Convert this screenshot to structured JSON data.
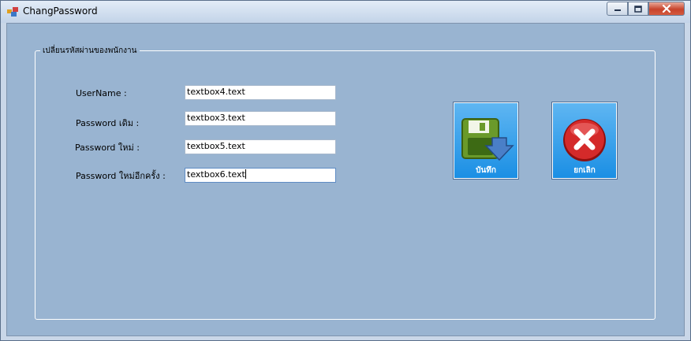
{
  "window": {
    "title": "ChangPassword"
  },
  "group": {
    "legend": "เปลี่ยนรหัสผ่านของพนักงาน"
  },
  "form": {
    "fields": [
      {
        "label": "UserName :",
        "value": "textbox4.text"
      },
      {
        "label": "Password เดิม :",
        "value": "textbox3.text"
      },
      {
        "label": "Password ใหม่ :",
        "value": "textbox5.text"
      },
      {
        "label": "Password ใหม่อีกครั้ง :",
        "value": "textbox6.text"
      }
    ]
  },
  "buttons": {
    "save_label": "บันทึก",
    "cancel_label": "ยกเลิก"
  },
  "icons": {
    "save": "floppy-disk-icon",
    "cancel": "red-x-icon",
    "app": "app-icon"
  },
  "colors": {
    "client_bg": "#99b4d1",
    "button_bg": "#1b8fe4",
    "cancel_red": "#d42a2a",
    "save_green": "#6a9a2a"
  }
}
